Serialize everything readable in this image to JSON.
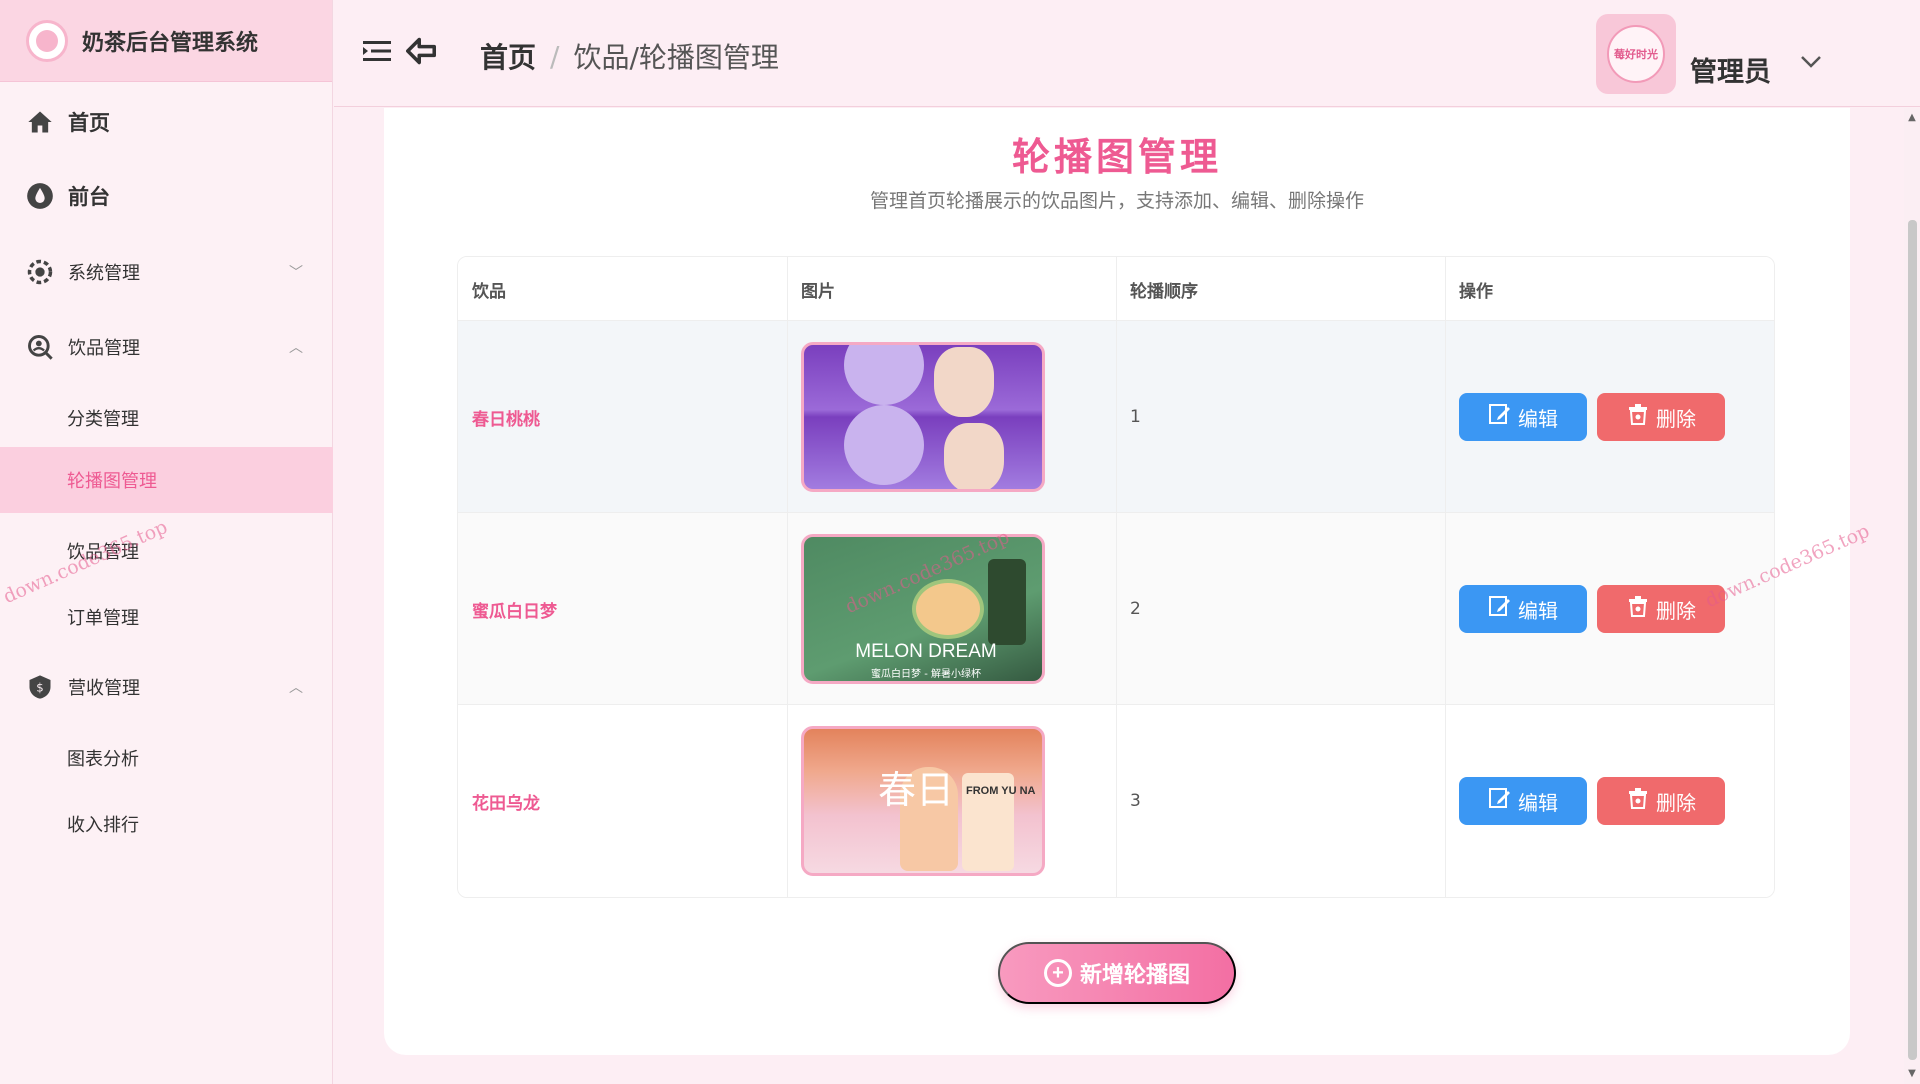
{
  "app": {
    "title": "奶茶后台管理系统"
  },
  "sidebar": {
    "items": [
      {
        "label": "首页",
        "icon": "home-icon"
      },
      {
        "label": "前台",
        "icon": "drop-icon"
      },
      {
        "label": "系统管理",
        "icon": "gear-icon",
        "expanded": false
      },
      {
        "label": "饮品管理",
        "icon": "search-user-icon",
        "expanded": true,
        "children": [
          {
            "label": "分类管理",
            "active": false
          },
          {
            "label": "轮播图管理",
            "active": true
          },
          {
            "label": "饮品管理",
            "active": false
          },
          {
            "label": "订单管理",
            "active": false
          }
        ]
      },
      {
        "label": "营收管理",
        "icon": "shield-icon",
        "expanded": true,
        "children": [
          {
            "label": "图表分析",
            "active": false
          },
          {
            "label": "收入排行",
            "active": false
          }
        ]
      }
    ]
  },
  "header": {
    "breadcrumb_home": "首页",
    "breadcrumb_sep": "/",
    "breadcrumb_current": "饮品/轮播图管理",
    "avatar_text": "莓好时光",
    "user_name": "管理员"
  },
  "page": {
    "title": "轮播图管理",
    "description": "管理首页轮播展示的饮品图片，支持添加、编辑、删除操作",
    "columns": [
      "饮品",
      "图片",
      "轮播顺序",
      "操作"
    ],
    "rows": [
      {
        "drink": "春日桃桃",
        "order": "1",
        "image": "purple-model-banner"
      },
      {
        "drink": "蜜瓜白日梦",
        "order": "2",
        "image": "melon-dream-banner",
        "image_title": "MELON DREAM",
        "image_subtitle": "蜜瓜白日梦 - 解暑小绿杯"
      },
      {
        "drink": "花田乌龙",
        "order": "3",
        "image": "spring-peach-banner",
        "image_big": "春日",
        "image_from": "FROM YU NA"
      }
    ],
    "edit_label": "编辑",
    "delete_label": "删除",
    "add_label": "新增轮播图"
  },
  "watermark": "down.code365.top",
  "colors": {
    "accent": "#ee5a92",
    "edit": "#3b97f3",
    "delete": "#f06a6c",
    "sidebar_active": "#fbcfdf"
  }
}
